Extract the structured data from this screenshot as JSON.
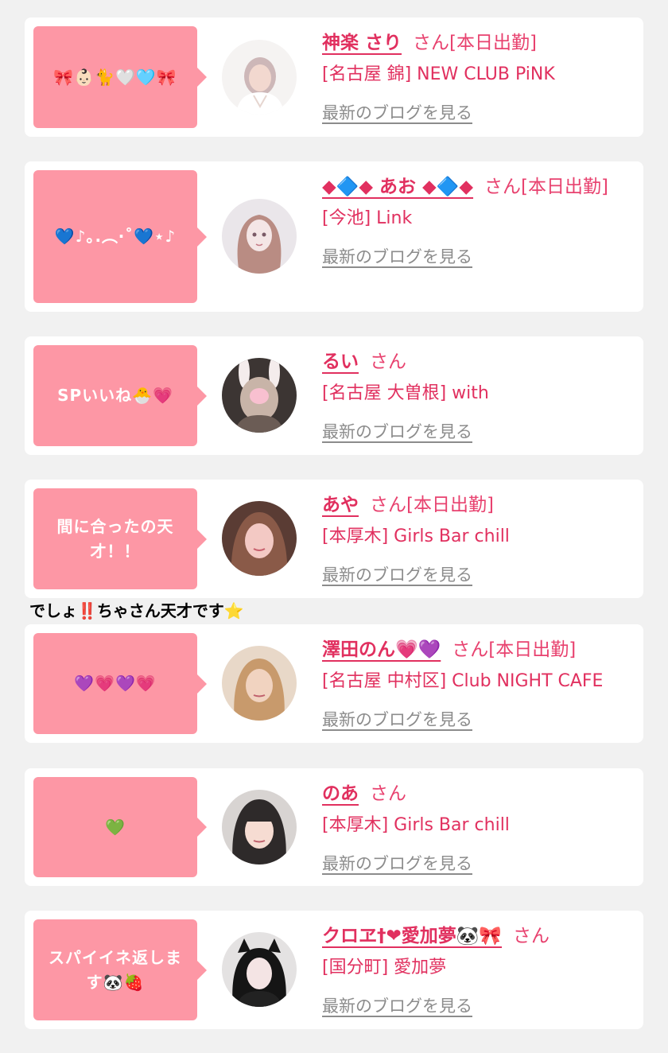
{
  "blog_link_label": "最新のブログを見る",
  "san_label": "さん",
  "entries": [
    {
      "comment": "🎀👶🏻🐈🤍🩵🎀",
      "name": "神楽 さり",
      "status": "[本日出勤]",
      "store": "[名古屋 錦] NEW CLUB PiNK"
    },
    {
      "comment": "💙♪｡.︵‧˚💙⋆♪",
      "name": "◆🔷◆ あお ◆🔷◆",
      "status": "[本日出勤]",
      "store": "[今池] Link"
    },
    {
      "comment": "SPいいね🐣💗",
      "name": "るい",
      "status": "",
      "store": "[名古屋 大曽根] with"
    },
    {
      "comment": "間に合ったの天才！！",
      "name": "あや",
      "status": "[本日出勤]",
      "store": "[本厚木] Girls Bar chill"
    },
    {
      "comment": "💜💗💜💗",
      "name": "澤田のん💗💜",
      "status": "[本日出勤]",
      "store": "[名古屋 中村区] Club NIGHT CAFE"
    },
    {
      "comment": "💚",
      "name": "のあ",
      "status": "",
      "store": "[本厚木] Girls Bar chill"
    },
    {
      "comment": "スパイイネ返します🐼🍓",
      "name": "クロヱ†❤︎愛加夢🐼🎀",
      "status": "",
      "store": "[国分町] 愛加夢"
    }
  ],
  "reply_note": "でしょ‼️ちゃさん天才です⭐️",
  "colors": {
    "page_bg": "#f1f1f1",
    "bubble_bg": "#fd97a5",
    "name_text": "#e1305f",
    "blog_link": "#8c8c8c"
  }
}
